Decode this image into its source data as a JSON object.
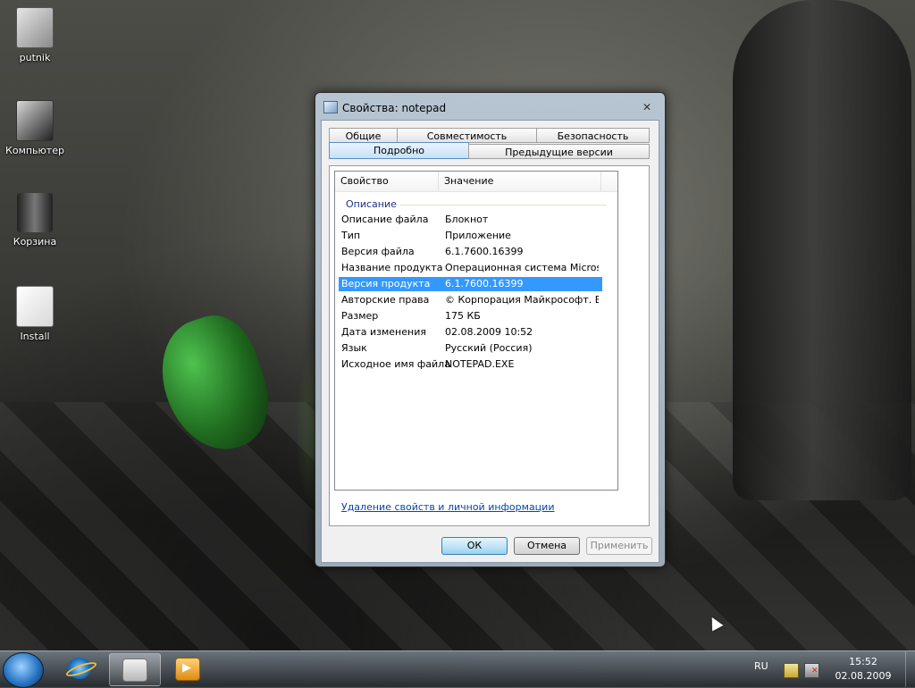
{
  "desktop": {
    "icons": [
      {
        "label": "putnik",
        "icon": "user-folder-icon"
      },
      {
        "label": "Компьютер",
        "icon": "computer-icon"
      },
      {
        "label": "Корзина",
        "icon": "recycle-bin-icon"
      },
      {
        "label": "Install",
        "icon": "folder-icon"
      }
    ]
  },
  "dialog": {
    "title": "Свойства: notepad",
    "close_glyph": "✕",
    "tabs": {
      "general": "Общие",
      "compatibility": "Совместимость",
      "security": "Безопасность",
      "details": "Подробно",
      "previous_versions": "Предыдущие версии"
    },
    "active_tab": "Подробно",
    "table": {
      "col_property": "Свойство",
      "col_value": "Значение",
      "group": "Описание",
      "rows": [
        {
          "key": "Описание файла",
          "value": "Блокнот"
        },
        {
          "key": "Тип",
          "value": "Приложение"
        },
        {
          "key": "Версия файла",
          "value": "6.1.7600.16399"
        },
        {
          "key": "Название продукта",
          "value": "Операционная система Microso..."
        },
        {
          "key": "Версия продукта",
          "value": "6.1.7600.16399"
        },
        {
          "key": "Авторские права",
          "value": "© Корпорация Майкрософт. Вс..."
        },
        {
          "key": "Размер",
          "value": "175 КБ"
        },
        {
          "key": "Дата изменения",
          "value": "02.08.2009 10:52"
        },
        {
          "key": "Язык",
          "value": "Русский (Россия)"
        },
        {
          "key": "Исходное имя файла",
          "value": "NOTEPAD.EXE"
        }
      ],
      "selected_row": "Версия продукта"
    },
    "remove_link": "Удаление свойств и личной информации",
    "buttons": {
      "ok": "ОК",
      "cancel": "Отмена",
      "apply": "Применить"
    }
  },
  "taskbar": {
    "pinned": [
      "internet-explorer-icon",
      "windows-explorer-icon",
      "media-player-icon"
    ],
    "language": "RU",
    "time": "15:52",
    "date": "02.08.2009"
  },
  "colors": {
    "selection": "#3399ff",
    "link": "#0645ad",
    "group_header": "#1e3287"
  }
}
